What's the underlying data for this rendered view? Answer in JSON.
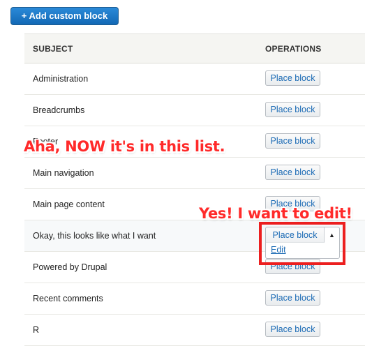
{
  "toolbar": {
    "add_label": "+ Add custom block"
  },
  "table": {
    "headers": {
      "subject": "SUBJECT",
      "operations": "OPERATIONS"
    },
    "rows": [
      {
        "subject": "Administration",
        "operation": "Place block"
      },
      {
        "subject": "Breadcrumbs",
        "operation": "Place block"
      },
      {
        "subject": "Footer",
        "operation": "Place block"
      },
      {
        "subject": "Main navigation",
        "operation": "Place block"
      },
      {
        "subject": "Main page content",
        "operation": "Place block"
      },
      {
        "subject": "Okay, this looks like what I want",
        "operation": "Place block",
        "dropdown_open": true
      },
      {
        "subject": "Powered by Drupal",
        "operation": "Place block"
      },
      {
        "subject": "Recent comments",
        "operation": "Place block"
      },
      {
        "subject": "R",
        "operation": "Place block"
      }
    ]
  },
  "dropbutton": {
    "main_label": "Place block",
    "toggle_icon": "triangle-up-icon",
    "edit_label": "Edit"
  },
  "annotations": {
    "callout_1": "Aha, NOW it's in this list.",
    "callout_2": "Yes! I want to edit!",
    "color": "#ff2a2a"
  },
  "colors": {
    "primary_button": "#1a74c4",
    "link": "#1c6bb5",
    "header_bg": "#f5f5f2",
    "annotation_red": "#ec1f1f"
  }
}
